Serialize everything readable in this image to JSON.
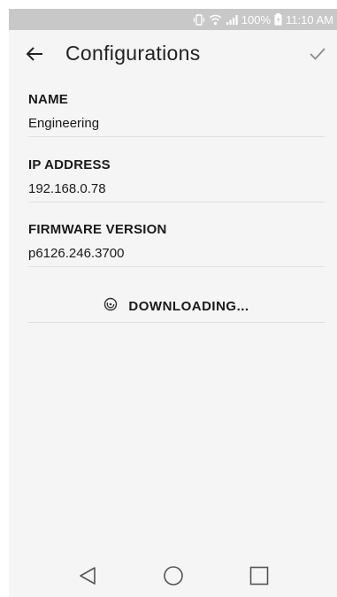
{
  "status_bar": {
    "battery": "100%",
    "time": "11:10 AM",
    "icons": [
      "vibrate-icon",
      "wifi-icon",
      "signal-icon",
      "battery-icon"
    ]
  },
  "app_bar": {
    "title": "Configurations",
    "back_icon": "arrow-left-icon",
    "confirm_icon": "checkmark-icon"
  },
  "fields": {
    "name": {
      "label": "NAME",
      "value": "Engineering"
    },
    "ip_address": {
      "label": "IP ADDRESS",
      "value": "192.168.0.78"
    },
    "firmware": {
      "label": "FIRMWARE VERSION",
      "value": "p6126.246.3700"
    }
  },
  "download": {
    "label": "DOWNLOADING...",
    "icon": "spinner-icon"
  },
  "nav_bar": {
    "icons": [
      "back-triangle-icon",
      "home-circle-icon",
      "recents-square-icon"
    ]
  },
  "colors": {
    "status_bar_bg": "#c8c8c8",
    "screen_bg": "#f5f5f5",
    "text": "#1a1a1a",
    "divider": "#e0e0e0"
  }
}
